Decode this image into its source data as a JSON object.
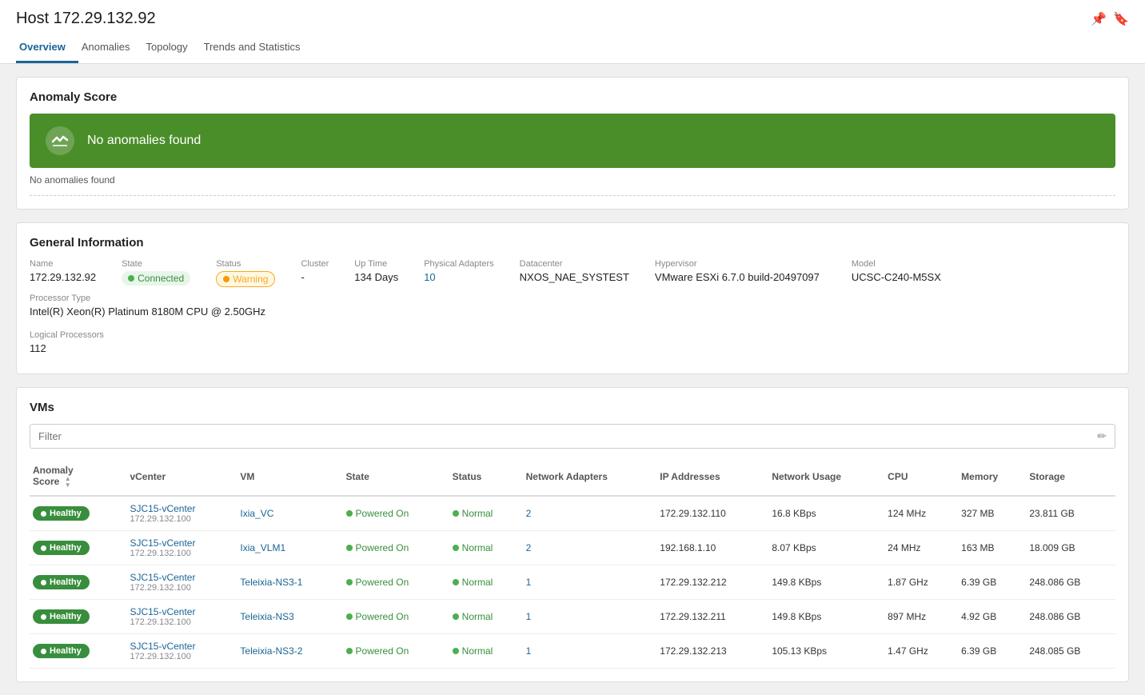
{
  "header": {
    "title": "Host 172.29.132.92",
    "pin_icon": "📌",
    "bookmark_icon": "🔖"
  },
  "tabs": [
    {
      "id": "overview",
      "label": "Overview",
      "active": true
    },
    {
      "id": "anomalies",
      "label": "Anomalies",
      "active": false
    },
    {
      "id": "topology",
      "label": "Topology",
      "active": false
    },
    {
      "id": "trends",
      "label": "Trends and Statistics",
      "active": false
    }
  ],
  "anomaly_score": {
    "section_title": "Anomaly Score",
    "banner_text": "No anomalies found",
    "note_text": "No anomalies found"
  },
  "general_info": {
    "section_title": "General Information",
    "fields": {
      "name_label": "Name",
      "name_value": "172.29.132.92",
      "state_label": "State",
      "state_value": "Connected",
      "status_label": "Status",
      "status_value": "Warning",
      "cluster_label": "Cluster",
      "cluster_value": "-",
      "uptime_label": "Up Time",
      "uptime_value": "134 Days",
      "physical_adapters_label": "Physical Adapters",
      "physical_adapters_value": "10",
      "datacenter_label": "Datacenter",
      "datacenter_value": "NXOS_NAE_SYSTEST",
      "hypervisor_label": "Hypervisor",
      "hypervisor_value": "VMware ESXi 6.7.0 build-20497097",
      "model_label": "Model",
      "model_value": "UCSC-C240-M5SX",
      "processor_label": "Processor Type",
      "processor_value": "Intel(R) Xeon(R) Platinum 8180M CPU @ 2.50GHz",
      "logical_processors_label": "Logical Processors",
      "logical_processors_value": "112"
    }
  },
  "vms": {
    "section_title": "VMs",
    "filter_placeholder": "Filter",
    "columns": [
      {
        "id": "anomaly",
        "label": "Anomaly Score",
        "sortable": true
      },
      {
        "id": "vcenter",
        "label": "vCenter",
        "sortable": false
      },
      {
        "id": "vm",
        "label": "VM",
        "sortable": false
      },
      {
        "id": "state",
        "label": "State",
        "sortable": false
      },
      {
        "id": "status",
        "label": "Status",
        "sortable": false
      },
      {
        "id": "network_adapters",
        "label": "Network Adapters",
        "sortable": false
      },
      {
        "id": "ip_addresses",
        "label": "IP Addresses",
        "sortable": false
      },
      {
        "id": "network_usage",
        "label": "Network Usage",
        "sortable": false
      },
      {
        "id": "cpu",
        "label": "CPU",
        "sortable": false
      },
      {
        "id": "memory",
        "label": "Memory",
        "sortable": false
      },
      {
        "id": "storage",
        "label": "Storage",
        "sortable": false
      }
    ],
    "rows": [
      {
        "anomaly": "Healthy",
        "vcenter": "SJC15-vCenter",
        "vcenter_ip": "172.29.132.100",
        "vm": "Ixia_VC",
        "state": "Powered On",
        "status": "Normal",
        "network_adapters": "2",
        "ip_addresses": "172.29.132.110",
        "network_usage": "16.8 KBps",
        "cpu": "124 MHz",
        "memory": "327 MB",
        "storage": "23.811 GB"
      },
      {
        "anomaly": "Healthy",
        "vcenter": "SJC15-vCenter",
        "vcenter_ip": "172.29.132.100",
        "vm": "Ixia_VLM1",
        "state": "Powered On",
        "status": "Normal",
        "network_adapters": "2",
        "ip_addresses": "192.168.1.10",
        "network_usage": "8.07 KBps",
        "cpu": "24 MHz",
        "memory": "163 MB",
        "storage": "18.009 GB"
      },
      {
        "anomaly": "Healthy",
        "vcenter": "SJC15-vCenter",
        "vcenter_ip": "172.29.132.100",
        "vm": "Teleixia-NS3-1",
        "state": "Powered On",
        "status": "Normal",
        "network_adapters": "1",
        "ip_addresses": "172.29.132.212",
        "network_usage": "149.8 KBps",
        "cpu": "1.87 GHz",
        "memory": "6.39 GB",
        "storage": "248.086 GB"
      },
      {
        "anomaly": "Healthy",
        "vcenter": "SJC15-vCenter",
        "vcenter_ip": "172.29.132.100",
        "vm": "Teleixia-NS3",
        "state": "Powered On",
        "status": "Normal",
        "network_adapters": "1",
        "ip_addresses": "172.29.132.211",
        "network_usage": "149.8 KBps",
        "cpu": "897 MHz",
        "memory": "4.92 GB",
        "storage": "248.086 GB"
      },
      {
        "anomaly": "Healthy",
        "vcenter": "SJC15-vCenter",
        "vcenter_ip": "172.29.132.100",
        "vm": "Teleixia-NS3-2",
        "state": "Powered On",
        "status": "Normal",
        "network_adapters": "1",
        "ip_addresses": "172.29.132.213",
        "network_usage": "105.13 KBps",
        "cpu": "1.47 GHz",
        "memory": "6.39 GB",
        "storage": "248.085 GB"
      }
    ]
  }
}
